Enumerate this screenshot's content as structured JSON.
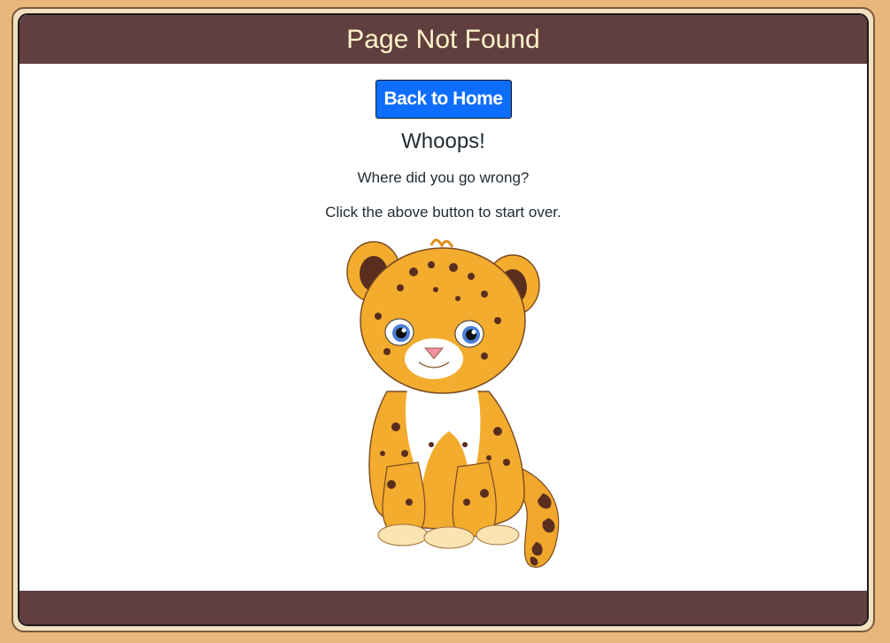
{
  "header": {
    "title": "Page Not Found"
  },
  "main": {
    "home_button_label": "Back to Home",
    "heading": "Whoops!",
    "message_1": "Where did you go wrong?",
    "message_2": "Click the above button to start over."
  },
  "image": {
    "subject": "leopard-cub-illustration"
  },
  "colors": {
    "page_background": "#e8b77b",
    "header_footer": "#623f3f",
    "header_text": "#fff4cc",
    "button": "#0d6efd"
  }
}
